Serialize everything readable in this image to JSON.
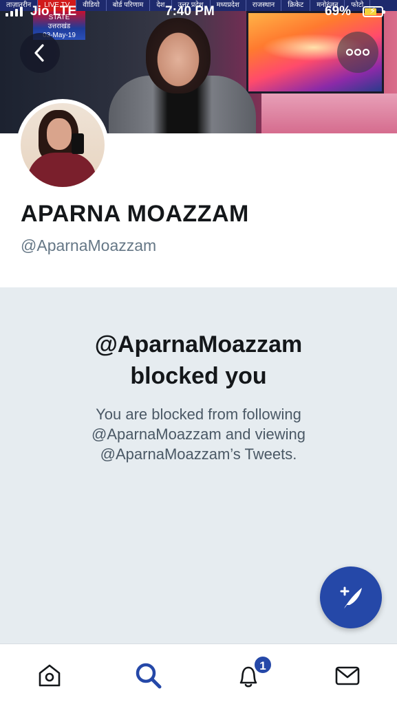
{
  "status_bar": {
    "carrier": "Jio  LTE",
    "time": "7:40 PM",
    "battery_percent": "69%",
    "battery_level": 0.69,
    "charging": true
  },
  "banner": {
    "ticker_items": [
      "ताज़ातरीन",
      "LIVE TV",
      "वीडियो",
      "बोर्ड परिणाम",
      "देश",
      "उत्तर प्रदेश",
      "मध्यप्रदेश",
      "राजस्थान",
      "क्रिकेट",
      "मनोरंजन",
      "फोटो"
    ],
    "logo_lines": [
      "STATE",
      "उत्तराखंड",
      "03-May-19"
    ]
  },
  "header": {
    "back_icon": "chevron-left-icon",
    "more_icon": "more-horizontal-icon"
  },
  "profile": {
    "name": "APARNA MOAZZAM",
    "handle": "@AparnaMoazzam"
  },
  "blocked": {
    "title_line1": "@AparnaMoazzam",
    "title_line2": "blocked you",
    "desc_line1": "You are blocked from following",
    "desc_line2": "@AparnaMoazzam and viewing",
    "desc_line3": "@AparnaMoazzam’s Tweets."
  },
  "compose": {
    "icon": "compose-tweet-icon"
  },
  "tabbar": {
    "tabs": [
      {
        "name": "home",
        "icon": "home-icon"
      },
      {
        "name": "search",
        "icon": "search-icon"
      },
      {
        "name": "notifications",
        "icon": "bell-icon"
      },
      {
        "name": "messages",
        "icon": "envelope-icon"
      }
    ],
    "notifications_badge": "1"
  },
  "colors": {
    "accent": "#2548a8",
    "panel_bg": "#e6ecf0",
    "text_primary": "#14171a",
    "text_secondary": "#657786"
  }
}
